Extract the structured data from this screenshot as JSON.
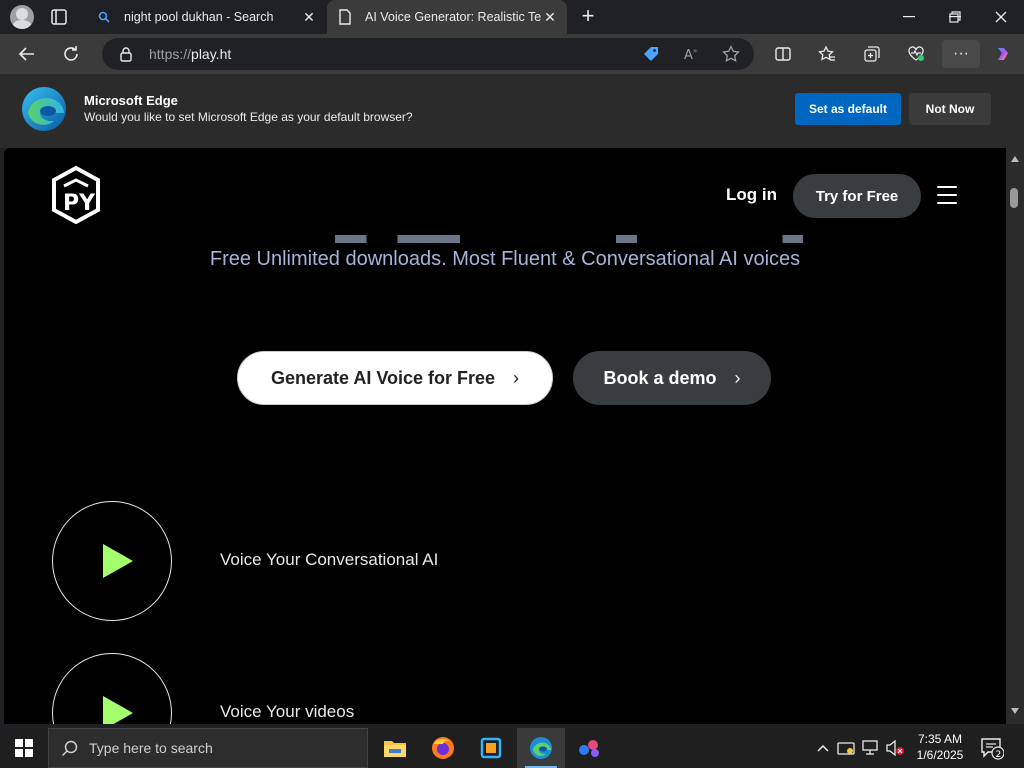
{
  "browser": {
    "tabs": [
      {
        "title": "night pool dukhan - Search",
        "close": "✕",
        "active": false
      },
      {
        "title": "AI Voice Generator: Realistic Text to Speech",
        "close": "✕",
        "active": true
      }
    ],
    "new_tab": "+",
    "window_controls": {
      "minimize": "—",
      "restore": "❐",
      "close": "✕"
    },
    "address": {
      "scheme": "https://",
      "host": "play.ht"
    },
    "menu": "···"
  },
  "infobar": {
    "title": "Microsoft Edge",
    "message": "Would you like to set Microsoft Edge as your default browser?",
    "set_default": "Set as default",
    "not_now": "Not Now"
  },
  "site": {
    "nav": {
      "login": "Log in",
      "try_free": "Try for Free"
    },
    "subtitle": "Free Unlimited downloads. Most Fluent & Conversational AI voices",
    "cta_primary": "Generate AI Voice for Free",
    "cta_secondary": "Book a demo",
    "cta_chevron": "›",
    "features": [
      {
        "label": "Voice Your Conversational AI"
      },
      {
        "label": "Voice Your videos"
      }
    ],
    "accent_color": "#a3ff6b"
  },
  "taskbar": {
    "search_placeholder": "Type here to search",
    "apps": [
      "file-explorer",
      "firefox",
      "sandbox-app",
      "edge",
      "app-icon"
    ],
    "clock_time": "7:35 AM",
    "clock_date": "1/6/2025",
    "notification_count": "2"
  }
}
